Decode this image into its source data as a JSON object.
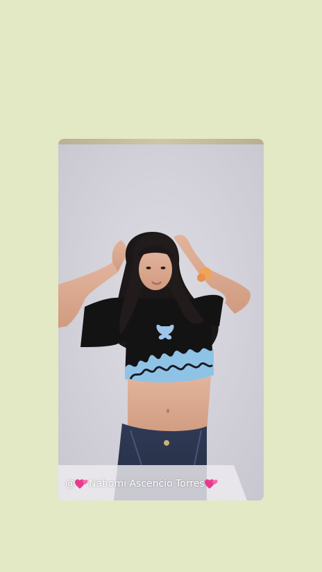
{
  "credit": {
    "prefix": "@",
    "name": "Nahomi Ascencio Torres",
    "heart_icon": "two-hearts-icon"
  },
  "colors": {
    "background": "#e3e9c5",
    "heart": "#e8398c"
  }
}
